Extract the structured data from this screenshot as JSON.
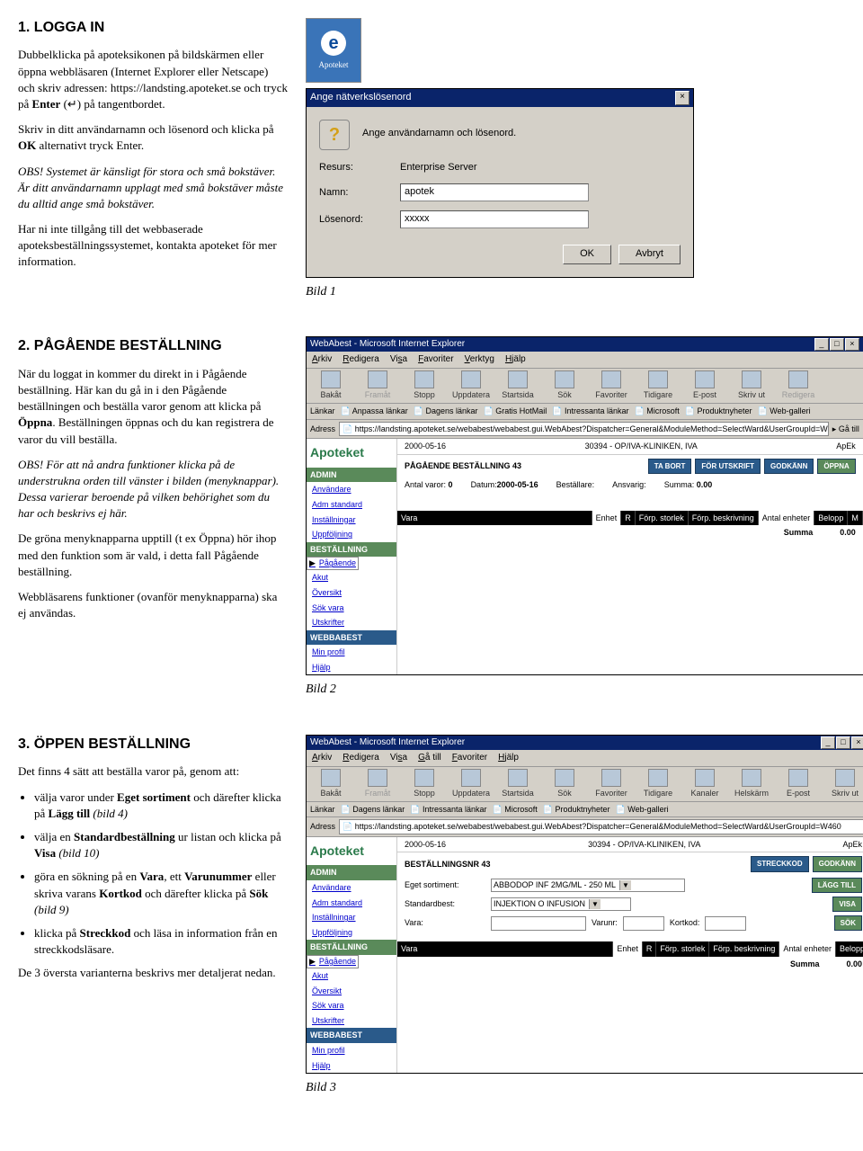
{
  "s1": {
    "h": "1. LOGGA IN",
    "p1a": "Dubbelklicka på apoteksikonen på bildskärmen eller öppna webbläsaren (Internet Explorer eller Netscape) och skriv adressen: https://landsting.apoteket.se och tryck på ",
    "p1b": "Enter",
    "p1c": " (↵) på tangentbordet.",
    "p2a": "Skriv in ditt användarnamn och lösenord och klicka på ",
    "p2b": "OK",
    "p2c": " alternativt tryck Enter.",
    "p3": "OBS! Systemet är känsligt för stora och små bokstäver. Är ditt användarnamn upplagt med små bokstäver måste du alltid ange små bokstäver.",
    "p4": "Har ni inte tillgång till det webbaserade apoteksbeställningssystemet, kontakta apoteket för mer information.",
    "cap": "Bild 1",
    "icon": "Apoteket",
    "dlg": {
      "title": "Ange nätverkslösenord",
      "msg": "Ange användarnamn och lösenord.",
      "resurs_l": "Resurs:",
      "resurs_v": "Enterprise Server",
      "namn_l": "Namn:",
      "namn_v": "apotek",
      "los_l": "Lösenord:",
      "los_v": "xxxxx",
      "ok": "OK",
      "avbryt": "Avbryt"
    }
  },
  "s2": {
    "h": "2. PÅGÅENDE BESTÄLLNING",
    "p1": "När du loggat in kommer du direkt in i Pågående beställning. Här kan du gå in i den Pågående beställningen och beställa varor genom att klicka på Öppna. Beställningen öppnas och du kan registrera de varor du vill beställa.",
    "p2": "OBS! För att nå andra funktioner klicka på de understrukna orden till vänster i bilden (menyknappar). Dessa varierar beroende på vilken behörighet som du har och beskrivs ej här.",
    "p3": "De gröna menyknapparna upptill (t ex Öppna) hör ihop med den funktion som är vald, i detta fall Pågående beställning.",
    "p4": "Webbläsarens funktioner (ovanför menyknapparna) ska ej användas.",
    "cap": "Bild 2"
  },
  "s3": {
    "h": "3. ÖPPEN BESTÄLLNING",
    "p1": "Det finns 4 sätt att beställa varor på, genom att:",
    "li1": "välja varor under Eget sortiment och därefter klicka på Lägg till (bild 4)",
    "li2": "välja en Standardbeställning ur listan och klicka på Visa (bild 10)",
    "li3": "göra en sökning på en Vara, ett Varunummer eller skriva varans Kortkod och därefter klicka på Sök (bild 9)",
    "li4": "klicka på Streckkod och läsa in information från en streckkodsläsare.",
    "p2": "De 3 översta varianterna beskrivs mer detaljerat nedan.",
    "cap": "Bild 3"
  },
  "ie": {
    "title": "WebAbest - Microsoft Internet Explorer",
    "menu": [
      "Arkiv",
      "Redigera",
      "Visa",
      "Favoriter",
      "Verktyg",
      "Hjälp"
    ],
    "menu3": [
      "Arkiv",
      "Redigera",
      "Visa",
      "Gå till",
      "Favoriter",
      "Hjälp"
    ],
    "tb": [
      "Bakåt",
      "Framåt",
      "Stopp",
      "Uppdatera",
      "Startsida",
      "Sök",
      "Favoriter",
      "Tidigare",
      "E-post",
      "Skriv ut",
      "Redigera"
    ],
    "tb3": [
      "Bakåt",
      "Framåt",
      "Stopp",
      "Uppdatera",
      "Startsida",
      "Sök",
      "Favoriter",
      "Tidigare",
      "Kanaler",
      "Helskärm",
      "E-post",
      "Skriv ut"
    ],
    "links": [
      "Anpassa länkar",
      "Dagens länkar",
      "Gratis HotMail",
      "Intressanta länkar",
      "Microsoft",
      "Produktnyheter",
      "Web-galleri"
    ],
    "links3": [
      "Dagens länkar",
      "Intressanta länkar",
      "Microsoft",
      "Produktnyheter",
      "Web-galleri"
    ],
    "lnk": "Länkar",
    "adr_l": "Adress",
    "adr": "https://landsting.apoteket.se/webabest/webabest.gui.WebAbest?Dispatcher=General&ModuleMethod=SelectWard&UserGroupId=W460",
    "ga": "Gå till"
  },
  "app": {
    "logo": "Apoteket",
    "date": "2000-05-16",
    "loc": "30394 - OP/IVA-KLINIKEN, IVA",
    "user": "ApEk",
    "admin": "ADMIN",
    "anv": "Användare",
    "adm_std": "Adm standard",
    "inst": "Inställningar",
    "uppf": "Uppföljning",
    "best": "BESTÄLLNING",
    "pag": "Pågående",
    "akut": "Akut",
    "ovs": "Översikt",
    "sokv": "Sök vara",
    "utsk": "Utskrifter",
    "wb": "WEBBABEST",
    "minp": "Min profil",
    "hjalp": "Hjälp",
    "pb_title": "PÅGÅENDE BESTÄLLNING 43",
    "tabort": "TA BORT",
    "forut": "FÖR UTSKRIFT",
    "godk": "GODKÄNN",
    "oppna": "ÖPPNA",
    "antal_l": "Antal varor:",
    "antal_v": "0",
    "datum_l": "Datum:",
    "datum_v": "2000-05-16",
    "best_l": "Beställare:",
    "ansv_l": "Ansvarig:",
    "summa_l": "Summa:",
    "summa_v": "0.00",
    "col_vara": "Vara",
    "col_enh": "Enhet",
    "col_r": "R",
    "col_fstl": "Förp. storlek",
    "col_fbes": "Förp. beskrivning",
    "col_aenh": "Antal enheter",
    "col_bel": "Belopp",
    "col_m": "M",
    "sum_txt": "Summa",
    "sum_val": "0.00",
    "bn_title": "BESTÄLLNINGSNR 43",
    "streck": "STRECKKOD",
    "laggtill": "LÄGG TILL",
    "visa": "VISA",
    "sok": "SÖK",
    "egs_l": "Eget sortiment:",
    "egs_v": "ABBODOP INF 2MG/ML - 250 ML",
    "stdb_l": "Standardbest:",
    "stdb_v": "INJEKTION O INFUSION",
    "vara_l": "Vara:",
    "varunr_l": "Varunr:",
    "kortkod_l": "Kortkod:"
  }
}
